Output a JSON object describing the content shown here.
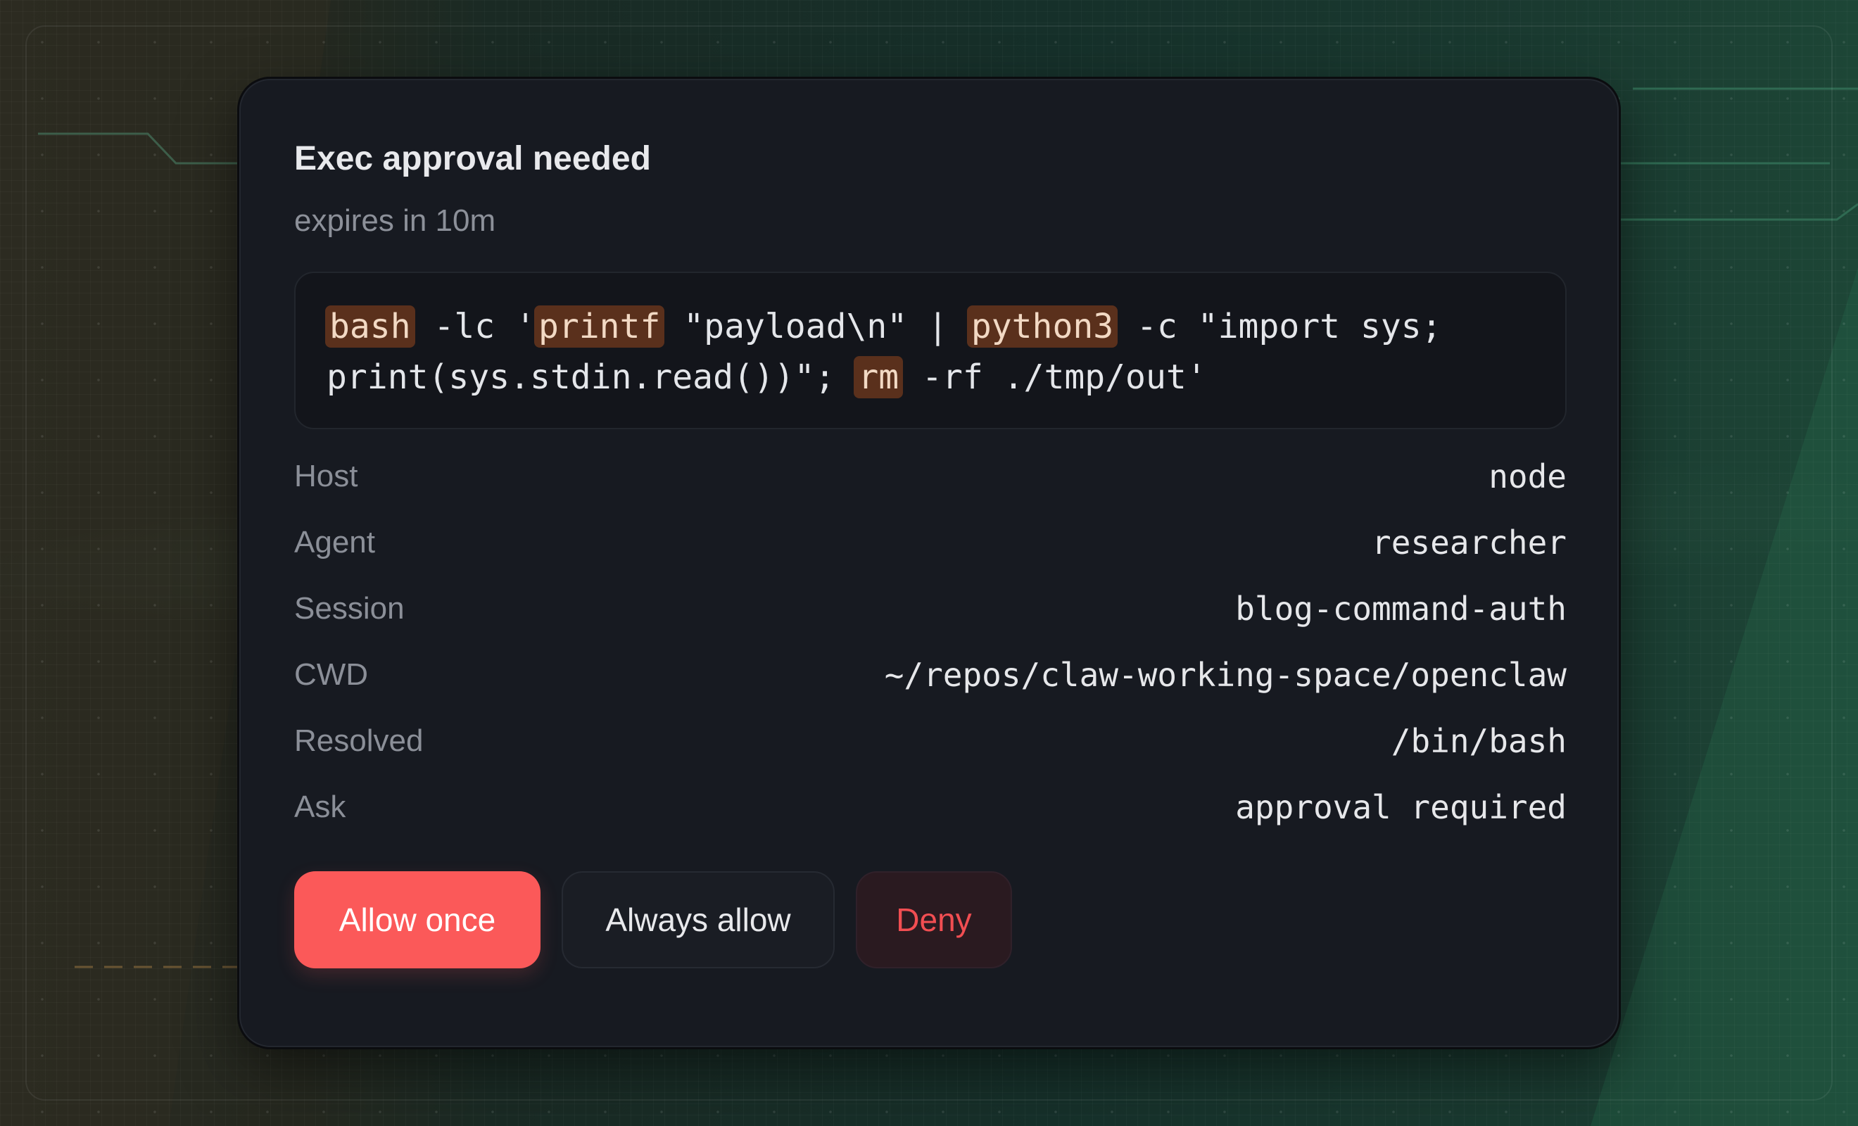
{
  "dialog": {
    "title": "Exec approval needed",
    "expires": "expires in 10m",
    "command": {
      "line1": [
        {
          "text": "bash",
          "highlight": true
        },
        {
          "text": " -lc '",
          "highlight": false
        },
        {
          "text": "printf",
          "highlight": true
        },
        {
          "text": " \"payload\\n\" | ",
          "highlight": false
        },
        {
          "text": "python3",
          "highlight": true
        },
        {
          "text": " -c \"import sys;",
          "highlight": false
        }
      ],
      "line2": [
        {
          "text": "print(sys.stdin.read())\"; ",
          "highlight": false
        },
        {
          "text": "rm",
          "highlight": true
        },
        {
          "text": " -rf ./tmp/out'",
          "highlight": false
        }
      ]
    },
    "details": [
      {
        "label": "Host",
        "value": "node"
      },
      {
        "label": "Agent",
        "value": "researcher"
      },
      {
        "label": "Session",
        "value": "blog-command-auth"
      },
      {
        "label": "CWD",
        "value": "~/repos/claw-working-space/openclaw"
      },
      {
        "label": "Resolved",
        "value": "/bin/bash"
      },
      {
        "label": "Ask",
        "value": "approval required"
      }
    ],
    "buttons": {
      "allow_once": "Allow once",
      "always_allow": "Always allow",
      "deny": "Deny"
    }
  },
  "colors": {
    "accent": "#fb5959",
    "deny_text": "#f14e52",
    "token_highlight": "#5a301c",
    "card_bg": "#171a21"
  }
}
